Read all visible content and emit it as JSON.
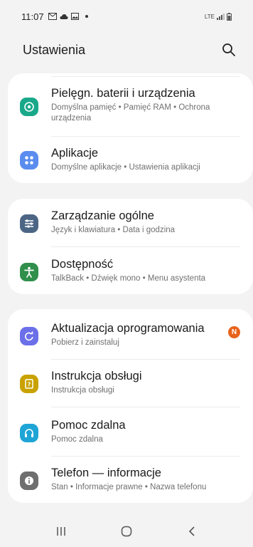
{
  "status_bar": {
    "time": "11:07",
    "notification_icons": [
      "mail-icon",
      "cloud-icon",
      "image-icon",
      "dot-icon"
    ],
    "network_label": "LTE",
    "status_icons": [
      "signal-icon",
      "battery-icon"
    ]
  },
  "header": {
    "title": "Ustawienia",
    "search_icon": "search-icon"
  },
  "groups": [
    {
      "items": [
        {
          "title": "Pielęgn. baterii i urządzenia",
          "subtitle": "Domyślna pamięć  •  Pamięć RAM  •  Ochrona urządzenia",
          "icon": "device-care-icon",
          "color": "#19a88a"
        },
        {
          "title": "Aplikacje",
          "subtitle": "Domyślne aplikacje  •  Ustawienia aplikacji",
          "icon": "apps-icon",
          "color": "#5b8def"
        }
      ]
    },
    {
      "items": [
        {
          "title": "Zarządzanie ogólne",
          "subtitle": "Język i klawiatura  •  Data i godzina",
          "icon": "sliders-icon",
          "color": "#4c6584"
        },
        {
          "title": "Dostępność",
          "subtitle": "TalkBack  •  Dźwięk mono  •  Menu asystenta",
          "icon": "accessibility-icon",
          "color": "#2f8f4b"
        }
      ]
    },
    {
      "items": [
        {
          "title": "Aktualizacja oprogramowania",
          "subtitle": "Pobierz i zainstaluj",
          "icon": "software-update-icon",
          "color": "#6b6fe8",
          "badge": "N"
        },
        {
          "title": "Instrukcja obsługi",
          "subtitle": "Instrukcja obsługi",
          "icon": "manual-icon",
          "color": "#c9a200"
        },
        {
          "title": "Pomoc zdalna",
          "subtitle": "Pomoc zdalna",
          "icon": "headset-icon",
          "color": "#1ea5d6"
        },
        {
          "title": "Telefon — informacje",
          "subtitle": "Stan  •  Informacje prawne  •  Nazwa telefonu",
          "icon": "info-icon",
          "color": "#6f6f6f"
        }
      ]
    }
  ],
  "nav_bar": {
    "recents_icon": "recents-icon",
    "home_icon": "home-icon",
    "back_icon": "back-icon"
  }
}
